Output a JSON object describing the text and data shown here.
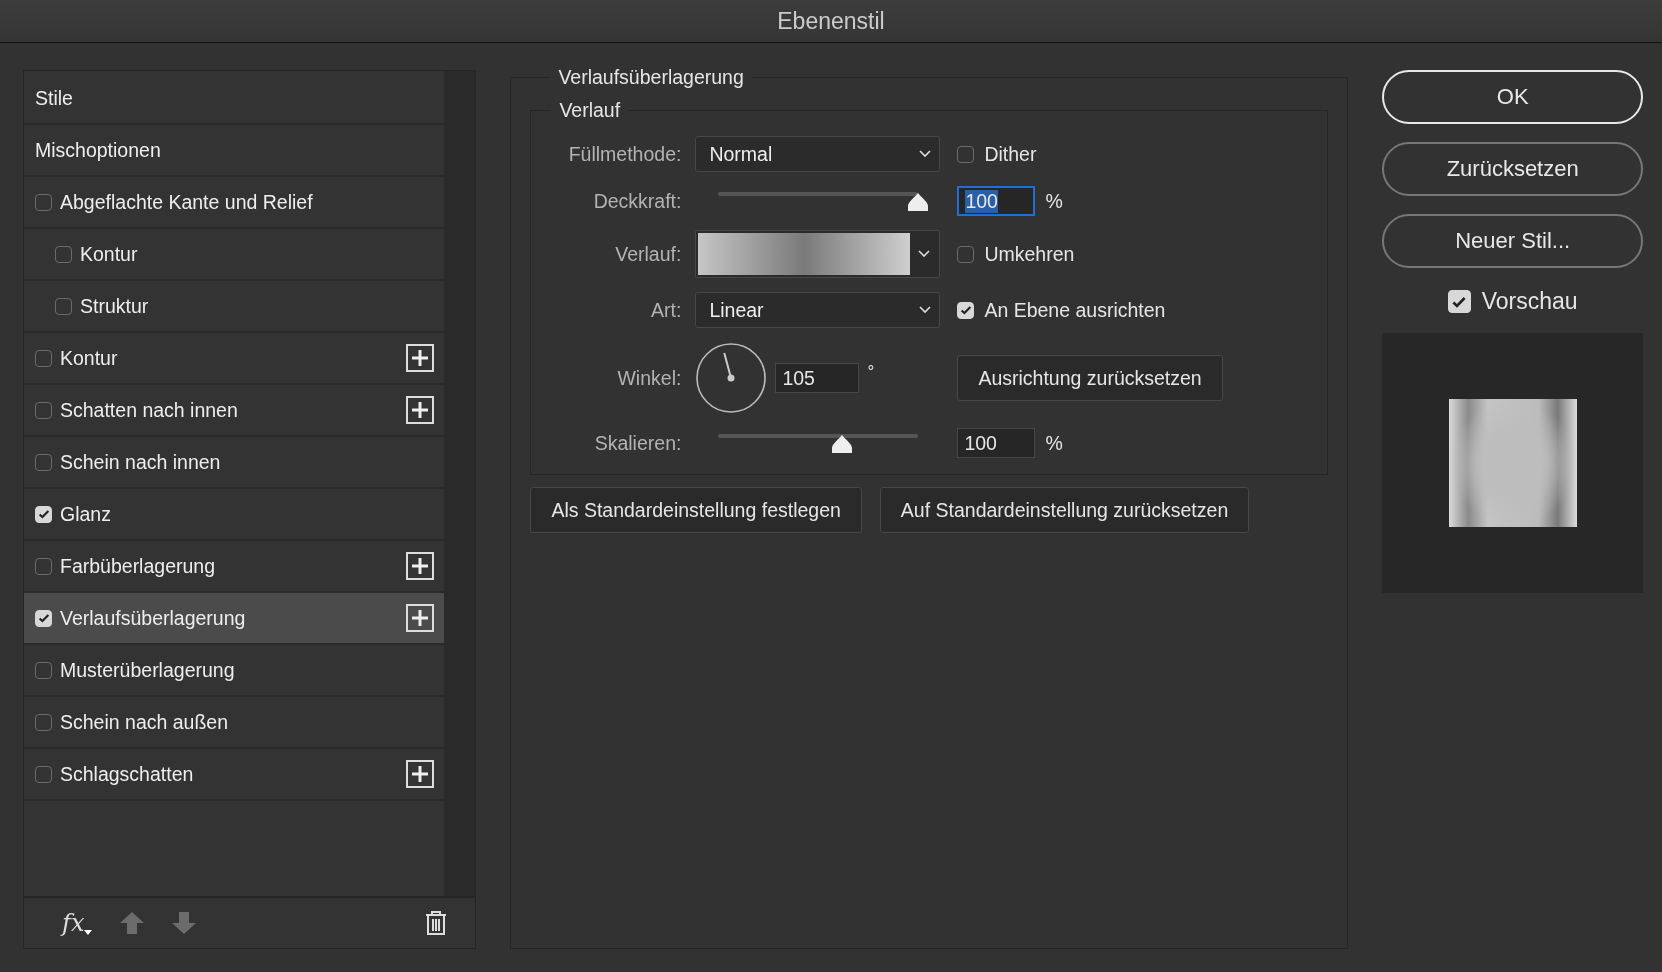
{
  "window": {
    "title": "Ebenenstil"
  },
  "styles_list": {
    "items": [
      {
        "kind": "header",
        "label": "Stile",
        "selected": false
      },
      {
        "kind": "header",
        "label": "Mischoptionen",
        "selected": false
      },
      {
        "kind": "checkbox",
        "label": "Abgeflachte Kante und Relief",
        "checked": false,
        "selected": false,
        "add_button": false,
        "children": [
          {
            "kind": "checkbox",
            "label": "Kontur",
            "checked": false,
            "selected": false,
            "add_button": false
          },
          {
            "kind": "checkbox",
            "label": "Struktur",
            "checked": false,
            "selected": false,
            "add_button": false
          }
        ]
      },
      {
        "kind": "checkbox",
        "label": "Kontur",
        "checked": false,
        "selected": false,
        "add_button": true
      },
      {
        "kind": "checkbox",
        "label": "Schatten nach innen",
        "checked": false,
        "selected": false,
        "add_button": true
      },
      {
        "kind": "checkbox",
        "label": "Schein nach innen",
        "checked": false,
        "selected": false,
        "add_button": false
      },
      {
        "kind": "checkbox",
        "label": "Glanz",
        "checked": true,
        "selected": false,
        "add_button": false
      },
      {
        "kind": "checkbox",
        "label": "Farbüberlagerung",
        "checked": false,
        "selected": false,
        "add_button": true
      },
      {
        "kind": "checkbox",
        "label": "Verlaufsüberlagerung",
        "checked": true,
        "selected": true,
        "add_button": true
      },
      {
        "kind": "checkbox",
        "label": "Musterüberlagerung",
        "checked": false,
        "selected": false,
        "add_button": false
      },
      {
        "kind": "checkbox",
        "label": "Schein nach außen",
        "checked": false,
        "selected": false,
        "add_button": false
      },
      {
        "kind": "checkbox",
        "label": "Schlagschatten",
        "checked": false,
        "selected": false,
        "add_button": true
      }
    ]
  },
  "toolbar": {
    "fx": "fx",
    "move_up_disabled": true,
    "move_down_disabled": true
  },
  "settings": {
    "title": "Verlaufsüberlagerung",
    "group_title": "Verlauf",
    "blend_mode": {
      "label": "Füllmethode:",
      "value": "Normal"
    },
    "dither": {
      "label": "Dither",
      "checked": false
    },
    "opacity": {
      "label": "Deckkraft:",
      "level": 1,
      "value": "100",
      "unit": "%",
      "focused": true
    },
    "gradient": {
      "label": "Verlauf:"
    },
    "reverse": {
      "label": "Umkehren",
      "checked": false
    },
    "style": {
      "label": "Art:",
      "value": "Linear"
    },
    "align": {
      "label": "An Ebene ausrichten",
      "checked": true
    },
    "angle": {
      "label": "Winkel:",
      "value": "105",
      "unit": "°"
    },
    "reset_alignment": "Ausrichtung zurücksetzen",
    "scale": {
      "label": "Skalieren:",
      "level": 0.62,
      "value": "100",
      "unit": "%",
      "focused": false
    },
    "buttons": [
      "Als Standardeinstellung festlegen",
      "Auf Standardeinstellung zurücksetzen"
    ]
  },
  "actions": {
    "buttons": [
      {
        "label": "OK",
        "default": true
      },
      {
        "label": "Zurücksetzen",
        "default": false
      },
      {
        "label": "Neuer Stil...",
        "default": false
      }
    ],
    "preview": {
      "label": "Vorschau",
      "checked": true
    }
  }
}
